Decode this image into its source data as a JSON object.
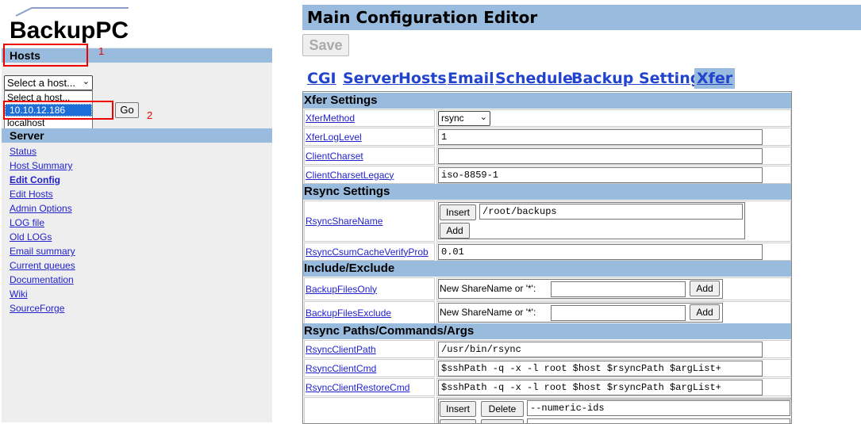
{
  "brand": {
    "logo_text": "BackupPC"
  },
  "sidebar": {
    "hosts_heading": "Hosts",
    "host_select": {
      "selected": "Select a host..."
    },
    "host_options": [
      "Select a host...",
      "10.10.12.186",
      "localhost"
    ],
    "go_label": "Go",
    "server_heading": "Server",
    "nav": [
      "Status",
      "Host Summary",
      "Edit Config",
      "Edit Hosts",
      "Admin Options",
      "LOG file",
      "Old LOGs",
      "Email summary",
      "Current queues",
      "Documentation",
      "Wiki",
      "SourceForge"
    ],
    "annotations": [
      "1",
      "2"
    ]
  },
  "main": {
    "title": "Main Configuration Editor",
    "save_label": "Save",
    "tabs": [
      "CGI",
      "Server",
      "Hosts",
      "Email",
      "Schedule",
      "Backup Settings",
      "Xfer"
    ],
    "active_tab": "Xfer",
    "sections": {
      "xfer": "Xfer Settings",
      "rsync": "Rsync Settings",
      "include": "Include/Exclude",
      "paths": "Rsync Paths/Commands/Args"
    },
    "fields": {
      "xfer_method": {
        "label": "XferMethod",
        "value": "rsync"
      },
      "xfer_log_level": {
        "label": "XferLogLevel",
        "value": "1"
      },
      "client_charset": {
        "label": "ClientCharset",
        "value": ""
      },
      "client_charset_legacy": {
        "label": "ClientCharsetLegacy",
        "value": "iso-8859-1"
      },
      "rsync_share_name": {
        "label": "RsyncShareName",
        "value": "/root/backups",
        "insert": "Insert",
        "add": "Add"
      },
      "rsync_csum": {
        "label": "RsyncCsumCacheVerifyProb",
        "value": "0.01"
      },
      "backup_files_only": {
        "label": "BackupFilesOnly",
        "prompt": "New ShareName or '*':",
        "add": "Add"
      },
      "backup_files_exclude": {
        "label": "BackupFilesExclude",
        "prompt": "New ShareName or '*':",
        "add": "Add"
      },
      "rsync_client_path": {
        "label": "RsyncClientPath",
        "value": "/usr/bin/rsync"
      },
      "rsync_client_cmd": {
        "label": "RsyncClientCmd",
        "value": "$sshPath -q -x -l root $host $rsyncPath $argList+"
      },
      "rsync_client_restore_cmd": {
        "label": "RsyncClientRestoreCmd",
        "value": "$sshPath -q -x -l root $host $rsyncPath $argList+"
      },
      "rsync_args": {
        "insert": "Insert",
        "delete": "Delete",
        "value": "--numeric-ids"
      }
    }
  }
}
